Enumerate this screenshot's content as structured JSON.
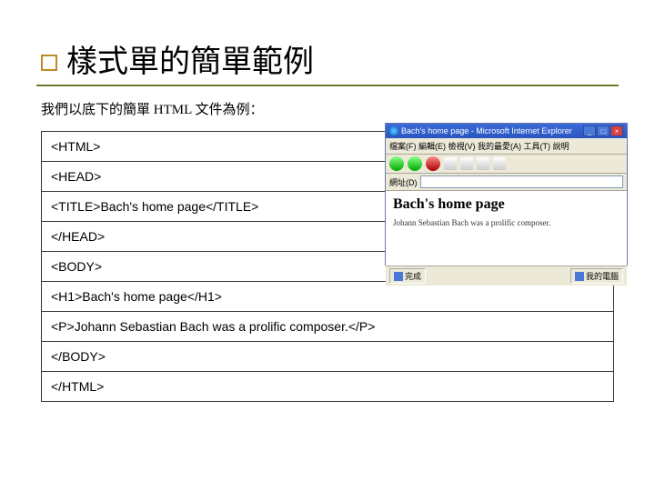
{
  "slide": {
    "title": "樣式單的簡單範例",
    "intro": "我們以底下的簡單 HTML 文件為例："
  },
  "code": {
    "lines": [
      "<HTML>",
      "<HEAD>",
      "<TITLE>Bach's home page</TITLE>",
      "</HEAD>",
      "<BODY>",
      "<H1>Bach's home page</H1>",
      "<P>Johann Sebastian Bach was a prolific composer.</P>",
      "</BODY>",
      "</HTML>"
    ]
  },
  "browser": {
    "title": "Bach's home page - Microsoft Internet Explorer",
    "menu": "檔案(F)  編輯(E)  檢視(V)  我的最愛(A)  工具(T)  說明",
    "address_label": "網址(D)",
    "heading": "Bach's home page",
    "paragraph": "Johann Sebastian Bach was a prolific composer.",
    "status_left": "完成",
    "status_right": "我的電腦"
  }
}
